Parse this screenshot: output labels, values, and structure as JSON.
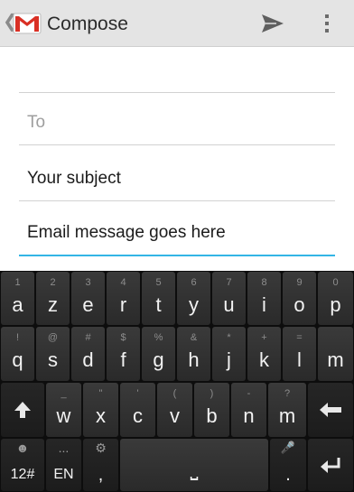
{
  "actionbar": {
    "title": "Compose",
    "up_caret": "❮",
    "icons": {
      "logo": "gmail-logo",
      "send": "send-icon",
      "overflow": "overflow-menu-icon"
    }
  },
  "form": {
    "from_value": "",
    "to_placeholder": "To",
    "subject_value": "Your subject",
    "body_value": "Email message goes here"
  },
  "keyboard": {
    "row1": [
      {
        "main": "a",
        "alt": "1"
      },
      {
        "main": "z",
        "alt": "2"
      },
      {
        "main": "e",
        "alt": "3"
      },
      {
        "main": "r",
        "alt": "4"
      },
      {
        "main": "t",
        "alt": "5"
      },
      {
        "main": "y",
        "alt": "6"
      },
      {
        "main": "u",
        "alt": "7"
      },
      {
        "main": "i",
        "alt": "8"
      },
      {
        "main": "o",
        "alt": "9"
      },
      {
        "main": "p",
        "alt": "0"
      }
    ],
    "row2": [
      {
        "main": "q",
        "alt": "!"
      },
      {
        "main": "s",
        "alt": "@"
      },
      {
        "main": "d",
        "alt": "#"
      },
      {
        "main": "f",
        "alt": "$"
      },
      {
        "main": "g",
        "alt": "%"
      },
      {
        "main": "h",
        "alt": "&"
      },
      {
        "main": "j",
        "alt": "*"
      },
      {
        "main": "k",
        "alt": "+"
      },
      {
        "main": "l",
        "alt": "="
      },
      {
        "main": "m",
        "alt": ""
      }
    ],
    "row3": [
      {
        "main": "w",
        "alt": "_"
      },
      {
        "main": "x",
        "alt": "\""
      },
      {
        "main": "c",
        "alt": "'"
      },
      {
        "main": "v",
        "alt": "("
      },
      {
        "main": "b",
        "alt": ")"
      },
      {
        "main": "n",
        "alt": "-"
      },
      {
        "main": "m",
        "alt": "?"
      }
    ],
    "row4": {
      "numbers_key": {
        "main": "12#",
        "alt": "☻"
      },
      "lang_key": {
        "main": "EN",
        "alt": "..."
      },
      "settings_key": {
        "main": ",",
        "alt": "⚙"
      },
      "space_key": {
        "main": "⎵"
      },
      "period_key": {
        "main": ".",
        "alt": "🎤"
      }
    },
    "icons": {
      "shift": "shift-icon",
      "backspace": "backspace-icon",
      "enter": "enter-icon",
      "emoji": "emoji-icon",
      "settings": "settings-icon",
      "mic": "mic-icon"
    }
  },
  "colors": {
    "actionbar_bg": "#e4e4e4",
    "focus_underline": "#33b5e5",
    "keyboard_bg": "#0d0d0d",
    "gmail_red": "#d93025"
  }
}
